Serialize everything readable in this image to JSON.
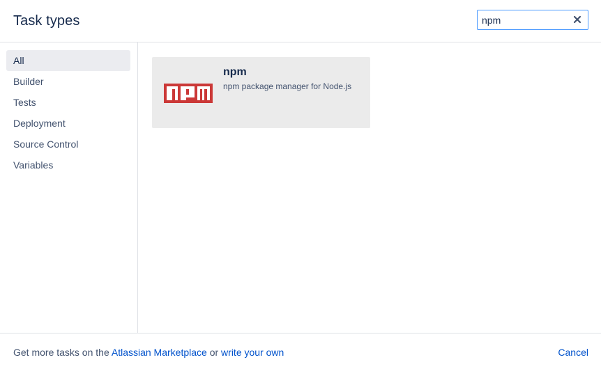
{
  "header": {
    "title": "Task types",
    "search_value": "npm",
    "clear_icon": "close-icon"
  },
  "sidebar": {
    "items": [
      {
        "label": "All",
        "active": true
      },
      {
        "label": "Builder",
        "active": false
      },
      {
        "label": "Tests",
        "active": false
      },
      {
        "label": "Deployment",
        "active": false
      },
      {
        "label": "Source Control",
        "active": false
      },
      {
        "label": "Variables",
        "active": false
      }
    ]
  },
  "results": [
    {
      "name": "npm",
      "description": "npm package manager for Node.js",
      "icon": "npm-logo-icon",
      "logo_color": "#cb3837"
    }
  ],
  "footer": {
    "prefix": "Get more tasks on the",
    "marketplace_link": "Atlassian Marketplace",
    "middle": "or",
    "write_link": "write your own",
    "cancel_label": "Cancel"
  },
  "colors": {
    "link": "#0052cc",
    "active_nav_bg": "#ebecf0",
    "card_bg": "#ebebeb",
    "search_border": "#4c9aff"
  }
}
